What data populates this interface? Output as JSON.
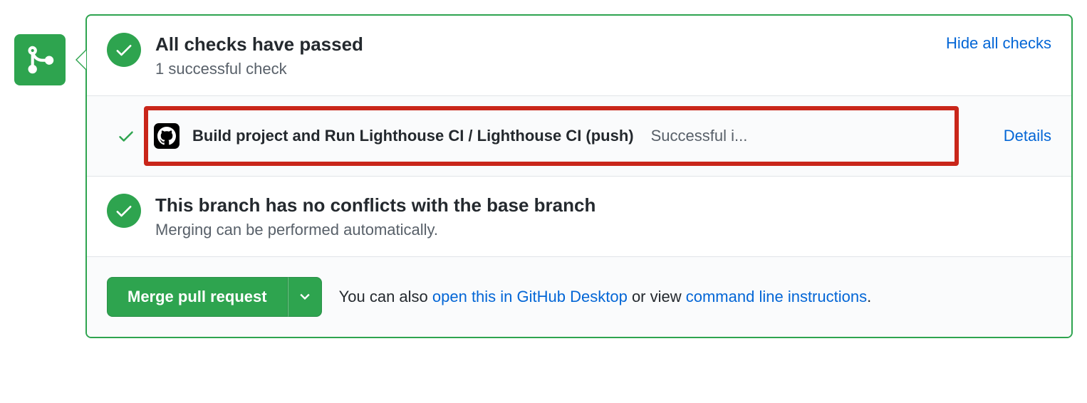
{
  "checks": {
    "title": "All checks have passed",
    "subtitle": "1 successful check",
    "hide_link": "Hide all checks",
    "items": [
      {
        "name": "Build project and Run Lighthouse CI / Lighthouse CI (push)",
        "status": "Successful i...",
        "details_label": "Details"
      }
    ]
  },
  "conflicts": {
    "title": "This branch has no conflicts with the base branch",
    "subtitle": "Merging can be performed automatically."
  },
  "merge": {
    "button_label": "Merge pull request",
    "footer_prefix": "You can also ",
    "desktop_link": "open this in GitHub Desktop",
    "footer_middle": " or view ",
    "cli_link": "command line instructions",
    "footer_suffix": "."
  }
}
